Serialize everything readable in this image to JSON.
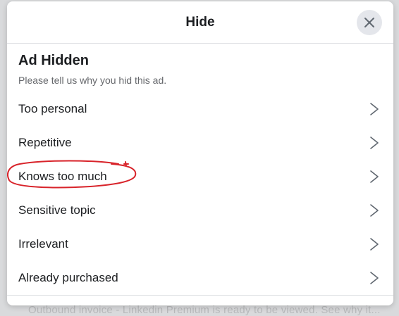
{
  "backdrop": {
    "text": "Outbound invoice - Linkedin Premium is ready to be viewed. See why it..."
  },
  "dialog": {
    "title": "Hide",
    "close_icon": "close-icon"
  },
  "section": {
    "title": "Ad Hidden",
    "subtitle": "Please tell us why you hid this ad."
  },
  "options": [
    {
      "label": "Too personal",
      "icon": "chevron-right-icon"
    },
    {
      "label": "Repetitive",
      "icon": "chevron-right-icon"
    },
    {
      "label": "Knows too much",
      "icon": "chevron-right-icon",
      "annotated": true
    },
    {
      "label": "Sensitive topic",
      "icon": "chevron-right-icon"
    },
    {
      "label": "Irrelevant",
      "icon": "chevron-right-icon"
    },
    {
      "label": "Already purchased",
      "icon": "chevron-right-icon"
    }
  ],
  "colors": {
    "annotation": "#d8232a",
    "close_button_bg": "#e4e6eb",
    "text_primary": "#1c1e21",
    "text_secondary": "#65676b"
  }
}
